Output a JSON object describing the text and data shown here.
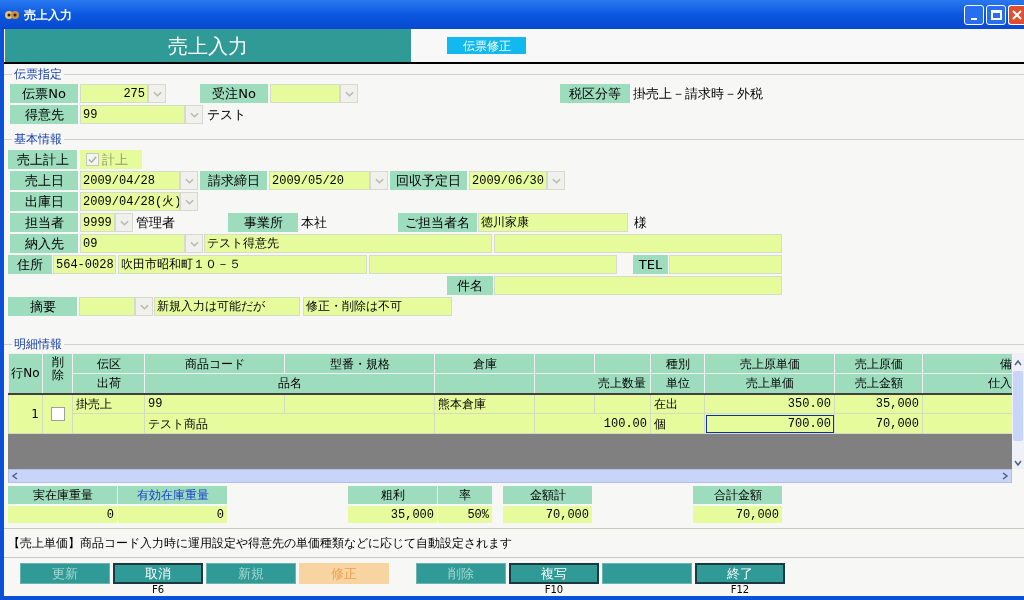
{
  "window": {
    "title": "売上入力"
  },
  "header": {
    "title": "売上入力",
    "mode_badge": "伝票修正"
  },
  "slip": {
    "legend": "伝票指定",
    "slip_no_label": "伝票No",
    "slip_no": "275",
    "order_no_label": "受注No",
    "tax_label": "税区分等",
    "tax_value": "掛売上－請求時－外税",
    "customer_label": "得意先",
    "customer_code": "99",
    "customer_name": "テスト"
  },
  "basic": {
    "legend": "基本情報",
    "posting_label": "売上計上",
    "posting": {
      "label": "計上",
      "checked": true,
      "disabled": true
    },
    "sales_date_label": "売上日",
    "sales_date": "2009/04/28",
    "billing_close_label": "請求締日",
    "billing_close": "2009/05/20",
    "collection_label": "回収予定日",
    "collection": "2009/06/30",
    "ship_date_label": "出庫日",
    "ship_date": "2009/04/28(火)",
    "staff_label": "担当者",
    "staff_code": "9999",
    "staff_name": "管理者",
    "office_label": "事業所",
    "office": "本社",
    "contact_label": "ご担当者名",
    "contact": "徳川家康",
    "honorific": "様",
    "delivery_label": "納入先",
    "delivery_code": "09",
    "delivery_name": "テスト得意先",
    "address_label": "住所",
    "postal": "564-0028",
    "address": "吹田市昭和町１０－５",
    "tel_label": "TEL",
    "subject_label": "件名",
    "summary_label": "摘要",
    "summary_1": "新規入力は可能だが",
    "summary_2": "修正・削除は不可"
  },
  "details": {
    "legend": "明細情報",
    "header_1": {
      "line_no": "行No",
      "delete": "削除",
      "slip_type": "伝区",
      "product_code": "商品コード",
      "model": "型番・規格",
      "warehouse": "倉庫",
      "category": "種別",
      "cost_unit_price": "売上原単価",
      "cost": "売上原価",
      "column_12": "備"
    },
    "header_2": {
      "shipping": "出荷",
      "product_name": "品名",
      "quantity": "売上数量",
      "unit": "単位",
      "unit_price": "売上単価",
      "amount": "売上金額",
      "column_12": "仕入"
    },
    "rows": [
      {
        "line_no": "1",
        "delete_checked": false,
        "unit_price_focused": true,
        "top": {
          "slip_type": "掛売上",
          "product_code": "99",
          "warehouse": "熊本倉庫",
          "category": "在出",
          "cost_unit_price": "350.00",
          "cost": "35,000"
        },
        "bottom": {
          "product_name": "テスト商品",
          "quantity": "100.00",
          "unit": "個",
          "unit_price": "700.00",
          "amount": "70,000"
        }
      }
    ]
  },
  "totals": [
    {
      "label": "実在庫重量",
      "value": "0",
      "kind": "plain"
    },
    {
      "label": "有効在庫重量",
      "value": "0",
      "kind": "link"
    },
    {
      "label": "粗利",
      "value": "35,000",
      "kind": "plain"
    },
    {
      "label": "率",
      "value": "50%",
      "kind": "plain"
    },
    {
      "label": "金額計",
      "value": "70,000",
      "kind": "plain"
    },
    {
      "label": "合計金額",
      "value": "70,000",
      "kind": "plain"
    }
  ],
  "hint": "【売上単価】商品コード入力時に運用設定や得意先の単価種類などに応じて自動設定されます",
  "buttons": [
    {
      "label": "更新",
      "enabled": false,
      "current": false
    },
    {
      "label": "取消",
      "enabled": true,
      "current": false,
      "key": "F6"
    },
    {
      "label": "新規",
      "enabled": false,
      "current": false
    },
    {
      "label": "修正",
      "enabled": false,
      "current": true
    },
    {
      "label": "削除",
      "enabled": false,
      "current": false
    },
    {
      "label": "複写",
      "enabled": true,
      "current": false,
      "key": "F10"
    },
    {
      "enabled": false,
      "current": false
    },
    {
      "label": "終了",
      "enabled": true,
      "current": false,
      "key": "F12"
    }
  ]
}
